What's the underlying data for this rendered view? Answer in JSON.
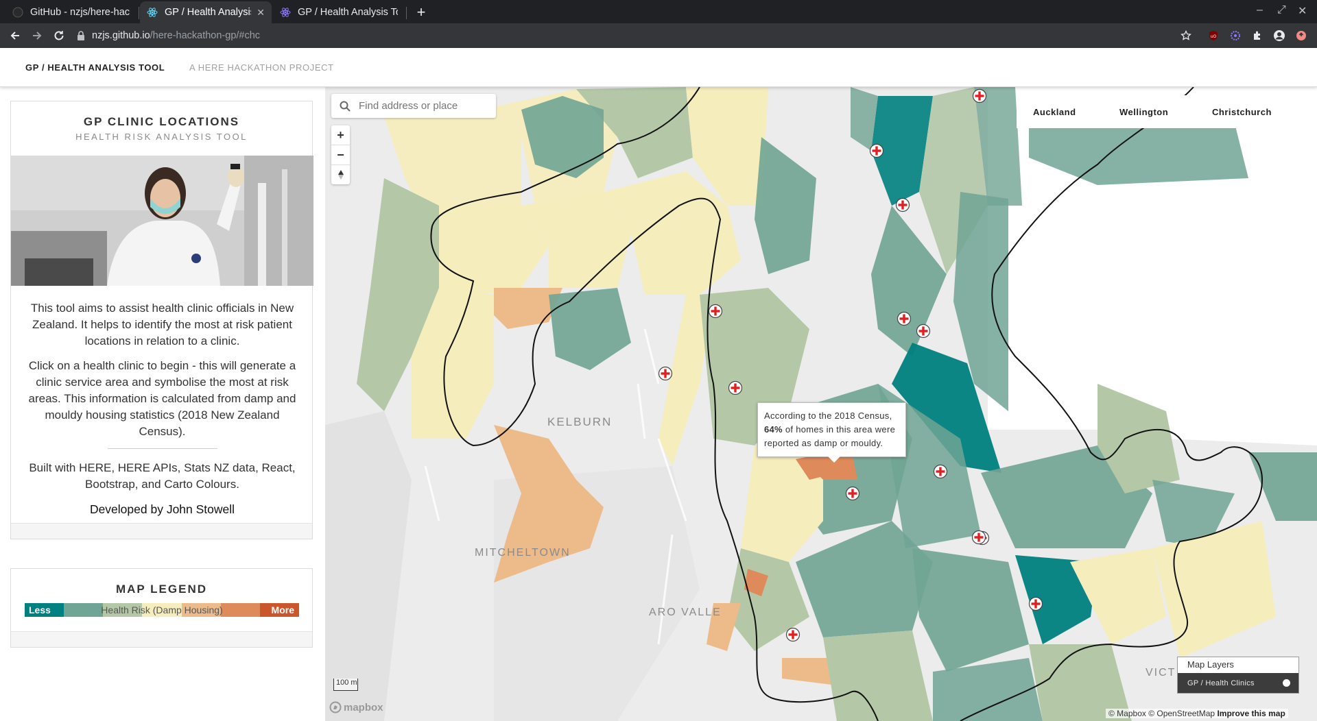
{
  "browser": {
    "tabs": [
      {
        "title": "GitHub - nzjs/here-hackat",
        "active": false,
        "icon": "github-icon"
      },
      {
        "title": "GP / Health Analysis Tool",
        "active": true,
        "icon": "react-icon"
      },
      {
        "title": "GP / Health Analysis Tool",
        "active": false,
        "icon": "react-icon"
      }
    ],
    "url_host": "nzjs.github.io",
    "url_path": "/here-hackathon-gp/#chc"
  },
  "navbar": {
    "brand": "GP / HEALTH ANALYSIS TOOL",
    "link": "A HERE HACKATHON PROJECT"
  },
  "sidebar": {
    "title": "GP CLINIC LOCATIONS",
    "subtitle": "HEALTH RISK ANALYSIS TOOL",
    "para1": "This tool aims to assist health clinic officials in New Zealand. It helps to identify the most at risk patient locations in relation to a clinic.",
    "para2": "Click on a health clinic to begin - this will generate a clinic service area and symbolise the most at risk areas. This information is calculated from damp and mouldy housing statistics (2018 New Zealand Census).",
    "para3": "Built with HERE, HERE APIs, Stats NZ data, React, Bootstrap, and Carto Colours.",
    "developer": "Developed by John Stowell"
  },
  "legend": {
    "title": "MAP LEGEND",
    "less": "Less",
    "label": "Health Risk (Damp Housing)",
    "more": "More",
    "colors": [
      "#008080",
      "#70a494",
      "#b4c8a8",
      "#f6edbd",
      "#edbb8a",
      "#de8a5a",
      "#ca562c"
    ]
  },
  "map": {
    "search_placeholder": "Find address or place",
    "zoom_in": "+",
    "zoom_out": "−",
    "cities": [
      "Auckland",
      "Wellington",
      "Christchurch"
    ],
    "tooltip_prefix": "According to the 2018 Census,",
    "tooltip_value": "64%",
    "tooltip_suffix": "of homes in this area were reported as damp or mouldy.",
    "labels": {
      "kelburn": "KELBURN",
      "mitchelltown": "MITCHELTOWN",
      "aro_valley": "ARO VALLE",
      "victoria": "VICT"
    },
    "layers_title": "Map Layers",
    "layer_name": "GP / Health Clinics",
    "scale": "100 m",
    "mapbox_logo": "mapbox",
    "attribution": "© Mapbox © OpenStreetMap",
    "improve": "Improve this map"
  }
}
